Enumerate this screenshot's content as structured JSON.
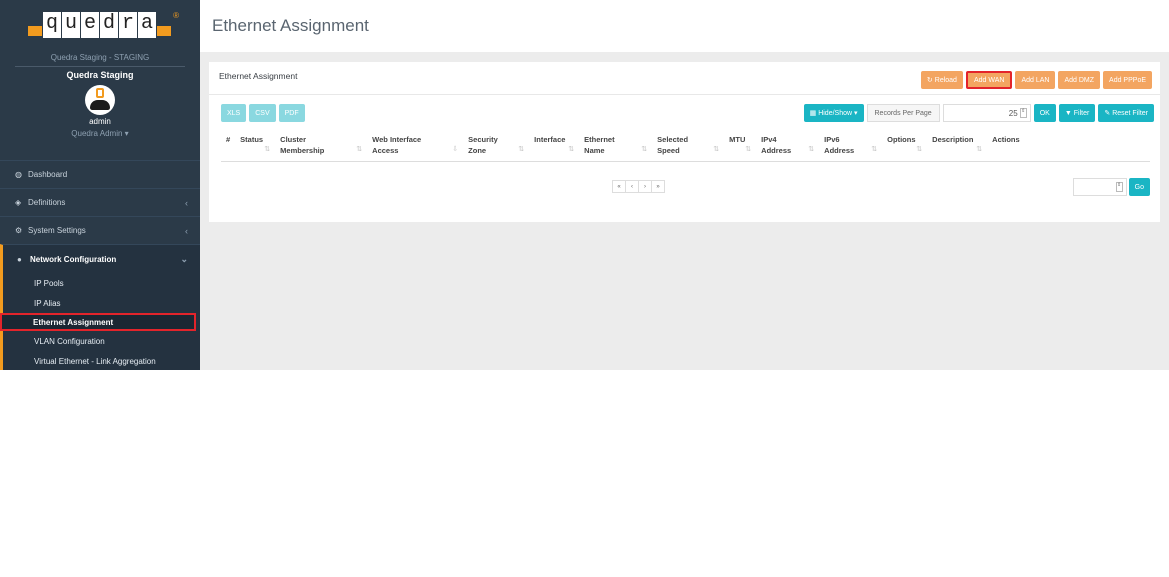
{
  "brand": {
    "logo_letters": [
      "q",
      "u",
      "e",
      "d",
      "r",
      "a"
    ],
    "reg_mark": "®",
    "accent_color": "#f29b1f"
  },
  "sidebar": {
    "org_name": "Quedra Staging - STAGING",
    "instance_name": "Quedra Staging",
    "user_name": "admin",
    "user_role": "Quedra Admin ▾",
    "nav": {
      "dashboard": {
        "label": "Dashboard",
        "icon": "dashboard-icon"
      },
      "definitions": {
        "label": "Definitions",
        "icon": "tags-icon"
      },
      "system_settings": {
        "label": "System Settings",
        "icon": "cogs-icon"
      },
      "network_configuration": {
        "label": "Network Configuration",
        "icon": "globe-icon",
        "items": [
          "IP Pools",
          "IP Alias",
          "Ethernet Assignment",
          "VLAN Configuration",
          "Virtual Ethernet - Link Aggregation"
        ]
      }
    }
  },
  "header": {
    "title": "Ethernet Assignment"
  },
  "panel": {
    "title": "Ethernet Assignment",
    "actions": {
      "reload": "Reload",
      "add_wan": "Add WAN",
      "add_lan": "Add LAN",
      "add_dmz": "Add DMZ",
      "add_pppoe": "Add PPPoE"
    },
    "export": {
      "xls": "XLS",
      "csv": "CSV",
      "pdf": "PDF"
    },
    "controls": {
      "hide_show": "Hide/Show ▾",
      "records_label": "Records Per Page",
      "records_value": "25",
      "ok": "OK",
      "filter": "Filter",
      "reset_filter": "Reset Filter"
    },
    "columns": [
      {
        "l1": "#",
        "l2": "",
        "sort": ""
      },
      {
        "l1": "Status",
        "l2": "",
        "sort": "⇅"
      },
      {
        "l1": "Cluster",
        "l2": "Membership",
        "sort": "⇅"
      },
      {
        "l1": "Web Interface",
        "l2": "Access",
        "sort": "⇩"
      },
      {
        "l1": "Security",
        "l2": "Zone",
        "sort": "⇅"
      },
      {
        "l1": "Interface",
        "l2": "",
        "sort": "⇅"
      },
      {
        "l1": "Ethernet",
        "l2": "Name",
        "sort": "⇅"
      },
      {
        "l1": "Selected",
        "l2": "Speed",
        "sort": "⇅"
      },
      {
        "l1": "MTU",
        "l2": "",
        "sort": "⇅"
      },
      {
        "l1": "IPv4",
        "l2": "Address",
        "sort": "⇅"
      },
      {
        "l1": "IPv6",
        "l2": "Address",
        "sort": "⇅"
      },
      {
        "l1": "Options",
        "l2": "",
        "sort": "⇅"
      },
      {
        "l1": "Description",
        "l2": "",
        "sort": "⇅"
      },
      {
        "l1": "Actions",
        "l2": "",
        "sort": ""
      }
    ],
    "pagination": {
      "first": "«",
      "prev": "‹",
      "next": "›",
      "last": "»"
    },
    "go_label": "Go"
  }
}
